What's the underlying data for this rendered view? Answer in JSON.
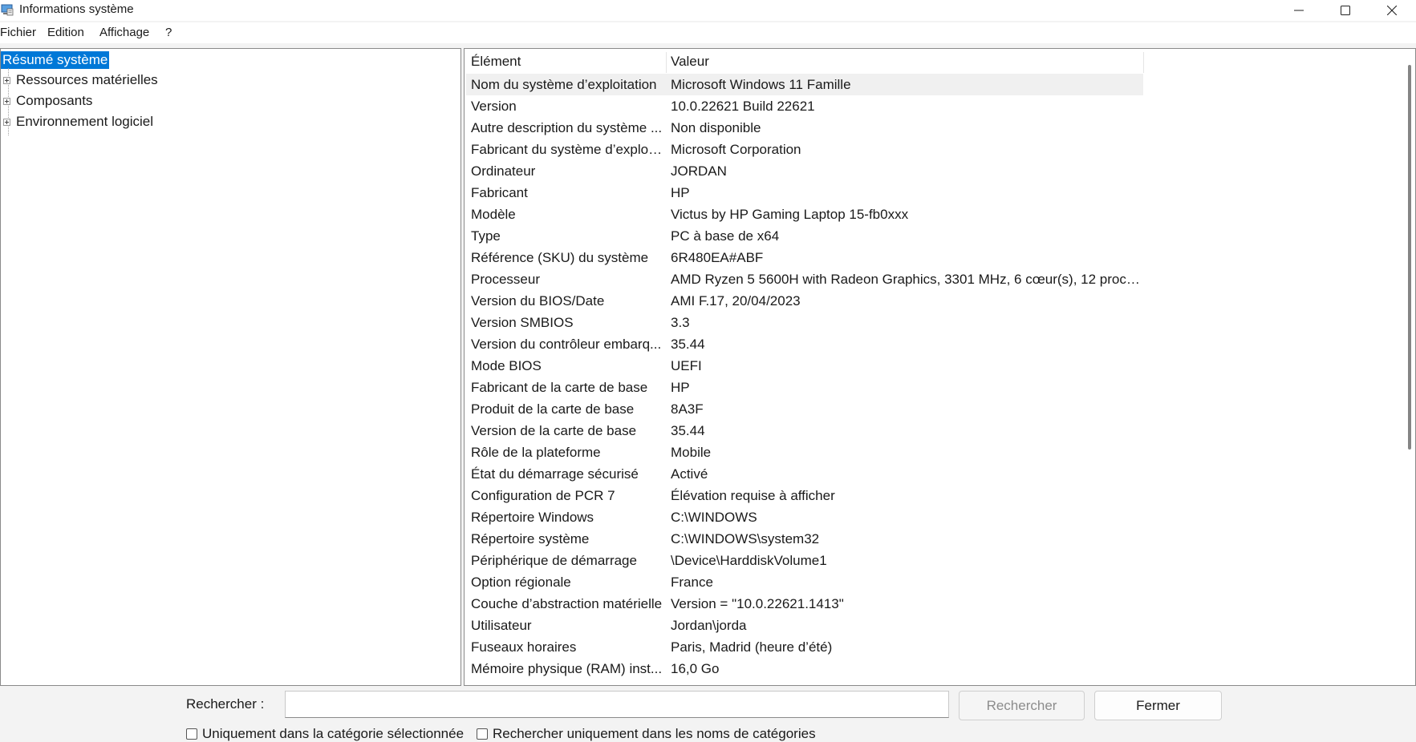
{
  "window": {
    "title": "Informations système",
    "buttons": {
      "minimize_icon": "minimize-icon",
      "maximize_icon": "maximize-icon",
      "close_icon": "close-icon"
    }
  },
  "menu": [
    "Fichier",
    "Edition",
    "Affichage",
    "?"
  ],
  "tree": {
    "items": [
      {
        "label": "Résumé système",
        "selected": true,
        "expandable": false
      },
      {
        "label": "Ressources matérielles",
        "selected": false,
        "expandable": true
      },
      {
        "label": "Composants",
        "selected": false,
        "expandable": true
      },
      {
        "label": "Environnement logiciel",
        "selected": false,
        "expandable": true
      }
    ]
  },
  "list": {
    "headers": {
      "element": "Élément",
      "value": "Valeur"
    },
    "rows": [
      {
        "name": "Nom du système d’exploitation",
        "value": "Microsoft Windows 11 Famille"
      },
      {
        "name": "Version",
        "value": "10.0.22621 Build 22621"
      },
      {
        "name": "Autre description du système ...",
        "value": "Non disponible"
      },
      {
        "name": "Fabricant du système d’exploit...",
        "value": "Microsoft Corporation"
      },
      {
        "name": "Ordinateur",
        "value": "JORDAN"
      },
      {
        "name": "Fabricant",
        "value": "HP"
      },
      {
        "name": "Modèle",
        "value": "Victus by HP Gaming Laptop 15-fb0xxx"
      },
      {
        "name": "Type",
        "value": "PC à base de x64"
      },
      {
        "name": "Référence (SKU) du système",
        "value": "6R480EA#ABF"
      },
      {
        "name": "Processeur",
        "value": "AMD Ryzen 5 5600H with Radeon Graphics, 3301 MHz, 6 cœur(s), 12 proce..."
      },
      {
        "name": "Version du BIOS/Date",
        "value": "AMI F.17, 20/04/2023"
      },
      {
        "name": "Version SMBIOS",
        "value": "3.3"
      },
      {
        "name": "Version du contrôleur embarq...",
        "value": "35.44"
      },
      {
        "name": "Mode BIOS",
        "value": "UEFI"
      },
      {
        "name": "Fabricant de la carte de base",
        "value": "HP"
      },
      {
        "name": "Produit de la carte de base",
        "value": "8A3F"
      },
      {
        "name": "Version de la carte de base",
        "value": "35.44"
      },
      {
        "name": "Rôle de la plateforme",
        "value": "Mobile"
      },
      {
        "name": "État du démarrage sécurisé",
        "value": "Activé"
      },
      {
        "name": "Configuration de PCR 7",
        "value": "Élévation requise à afficher"
      },
      {
        "name": "Répertoire Windows",
        "value": "C:\\WINDOWS"
      },
      {
        "name": "Répertoire système",
        "value": "C:\\WINDOWS\\system32"
      },
      {
        "name": "Périphérique de démarrage",
        "value": "\\Device\\HarddiskVolume1"
      },
      {
        "name": "Option régionale",
        "value": "France"
      },
      {
        "name": "Couche d’abstraction matérielle",
        "value": "Version = \"10.0.22621.1413\""
      },
      {
        "name": "Utilisateur",
        "value": "Jordan\\jorda"
      },
      {
        "name": "Fuseaux horaires",
        "value": "Paris, Madrid (heure d’été)"
      },
      {
        "name": "Mémoire physique (RAM) inst...",
        "value": "16,0 Go"
      }
    ]
  },
  "search": {
    "label": "Rechercher :",
    "value": "",
    "placeholder": "",
    "search_button": "Rechercher",
    "close_button": "Fermer",
    "option_selected_category": "Uniquement dans la catégorie sélectionnée",
    "option_category_names": "Rechercher uniquement dans les noms de catégories"
  },
  "colors": {
    "selection": "#0078d7",
    "background": "#f3f3f3"
  }
}
